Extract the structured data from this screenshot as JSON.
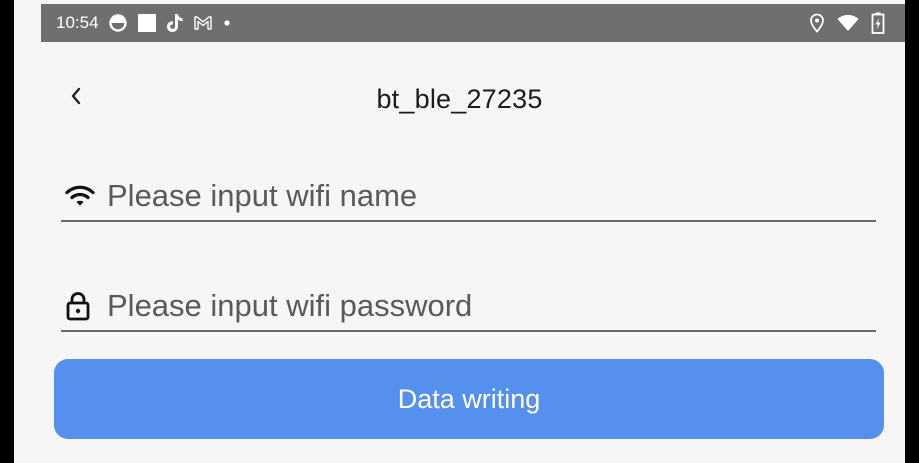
{
  "status_bar": {
    "time": "10:54",
    "left_icons": [
      "circle-app-icon",
      "square-app-icon",
      "tiktok-icon",
      "gmail-icon",
      "dot-icon"
    ],
    "right_icons": [
      "location-icon",
      "wifi-signal-icon",
      "battery-icon"
    ],
    "background_color": "#6f6f6f"
  },
  "header": {
    "back_icon": "chevron-left-icon",
    "title": "bt_ble_27235"
  },
  "form": {
    "wifi_name": {
      "icon": "wifi-icon",
      "placeholder": "Please input wifi name",
      "value": ""
    },
    "wifi_password": {
      "icon": "lock-icon",
      "placeholder": "Please input wifi password",
      "value": ""
    }
  },
  "actions": {
    "submit_label": "Data writing",
    "submit_color": "#5690ee"
  }
}
